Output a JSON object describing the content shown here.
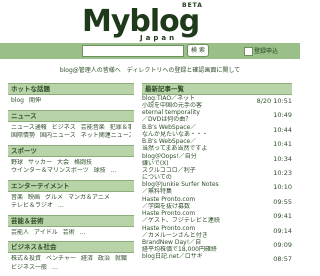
{
  "header": {
    "logo": "Myblog",
    "logo_beta": "BETA",
    "logo_sub": "Japan"
  },
  "search": {
    "button": "検 索",
    "checkbox_label": "登録申込"
  },
  "tagline": "blog@管理人の皆様へ　ディレクトリへの登録と確認画面に関して",
  "left": {
    "sections": [
      {
        "title": "ホットな話題",
        "lines": [
          [
            "blog",
            "開伸"
          ]
        ]
      },
      {
        "title": "ニュース",
        "lines": [
          [
            "ニュース通報",
            "ビジネス",
            "芸能音楽",
            "犯罪＆事件"
          ],
          [
            "国際情勢",
            "国内ニュース",
            "ネット関連ニュース"
          ]
        ]
      },
      {
        "title": "スポーツ",
        "lines": [
          [
            "野球",
            "サッカー",
            "大会",
            "格闘技"
          ],
          [
            "ウインター＆マリンスポーツ",
            "球技",
            "…"
          ]
        ]
      },
      {
        "title": "エンターテイメント",
        "lines": [
          [
            "音楽",
            "映画",
            "グルメ",
            "マンガ＆アニメ"
          ],
          [
            "テレビ＆ラジオ",
            "…"
          ]
        ]
      },
      {
        "title": "芸能＆芸術",
        "lines": [
          [
            "芸能人",
            "アイドル",
            "芸術",
            "…"
          ]
        ]
      },
      {
        "title": "ビジネス＆社会",
        "lines": [
          [
            "株式＆投資",
            "ベンチャー",
            "経済",
            "政治",
            "就職"
          ],
          [
            "ビジネス一般",
            "…"
          ]
        ]
      }
    ]
  },
  "right": {
    "title": "最新記事一覧",
    "posts": [
      {
        "t1": "blog:TIAO／ネット",
        "t2": "小説を中国の元手の客",
        "time": "8/20 10:51"
      },
      {
        "t1": "eternal temporality",
        "t2": "／DVDは何の曲？",
        "time": "10:49"
      },
      {
        "t1": "B.B's WebSpace／",
        "t2": "なんか見たいなあ・・・",
        "time": "10:44"
      },
      {
        "t1": "B.B's WebSpace／",
        "t2": "当然ってまあ当然ですよ",
        "time": "10:41"
      },
      {
        "t1": "blog＠Oops!／自分",
        "t2": "嫌いで(X)",
        "time": "10:34"
      },
      {
        "t1": "スクルココロ／利子",
        "t2": "についての",
        "time": "10:23"
      },
      {
        "t1": "blog＠Junkie Surfer Notes",
        "t2": "／無料特集",
        "time": "10:10"
      },
      {
        "t1": "Haste Pronto.com",
        "t2": "／学園を抜け募数",
        "time": "09:55"
      },
      {
        "t1": "Haste Pronto.com",
        "t2": "／ゲスト、フジテレビと連続",
        "time": "09:41"
      },
      {
        "t1": "Haste Pronto.com",
        "t2": "／カメルーンさんと付き",
        "time": "09:14"
      },
      {
        "t1": "BrandNew Day!／自",
        "t2": "経平均株価で18,000円確終",
        "time": "09:09"
      },
      {
        "t1": "blog日記.net／ロサギ",
        "t2": "",
        "time": "08:57"
      }
    ]
  }
}
